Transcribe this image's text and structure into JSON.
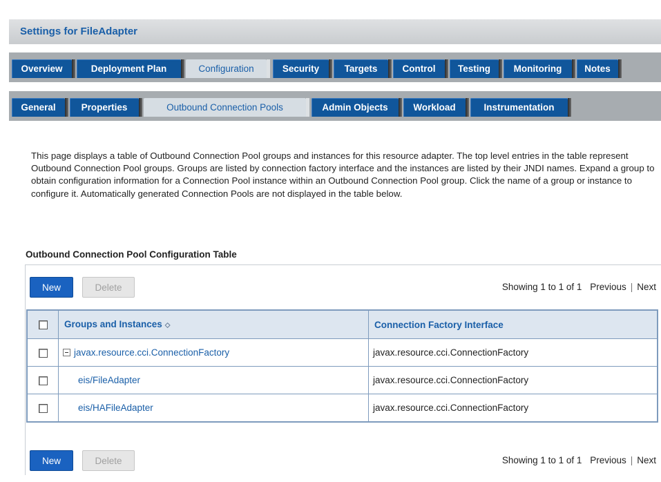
{
  "header": {
    "title": "Settings for FileAdapter"
  },
  "main_tabs": [
    {
      "label": "Overview",
      "active": false
    },
    {
      "label": "Deployment Plan",
      "active": false
    },
    {
      "label": "Configuration",
      "active": true
    },
    {
      "label": "Security",
      "active": false
    },
    {
      "label": "Targets",
      "active": false
    },
    {
      "label": "Control",
      "active": false
    },
    {
      "label": "Testing",
      "active": false
    },
    {
      "label": "Monitoring",
      "active": false
    },
    {
      "label": "Notes",
      "active": false
    }
  ],
  "sub_tabs": [
    {
      "label": "General",
      "active": false
    },
    {
      "label": "Properties",
      "active": false
    },
    {
      "label": "Outbound Connection Pools",
      "active": true
    },
    {
      "label": "Admin Objects",
      "active": false
    },
    {
      "label": "Workload",
      "active": false
    },
    {
      "label": "Instrumentation",
      "active": false
    }
  ],
  "description": "This page displays a table of Outbound Connection Pool groups and instances for this resource adapter. The top level entries in the table represent Outbound Connection Pool groups. Groups are listed by connection factory interface and the instances are listed by their JNDI names. Expand a group to obtain configuration information for a Connection Pool instance within an Outbound Connection Pool group. Click the name of a group or instance to configure it. Automatically generated Connection Pools are not displayed in the table below.",
  "table": {
    "title": "Outbound Connection Pool Configuration Table",
    "new_label": "New",
    "delete_label": "Delete",
    "showing": "Showing 1 to 1 of 1",
    "previous": "Previous",
    "next": "Next",
    "columns": [
      "Groups and Instances",
      "Connection Factory Interface"
    ],
    "rows": [
      {
        "name": "javax.resource.cci.ConnectionFactory",
        "interface": "javax.resource.cci.ConnectionFactory",
        "is_group": true
      },
      {
        "name": "eis/FileAdapter",
        "interface": "javax.resource.cci.ConnectionFactory",
        "is_group": false
      },
      {
        "name": "eis/HAFileAdapter",
        "interface": "javax.resource.cci.ConnectionFactory",
        "is_group": false
      }
    ]
  },
  "icons": {
    "sort": "sort-ascending-icon",
    "collapse": "collapse-minus-icon",
    "checkbox": "checkbox-icon"
  },
  "colors": {
    "tab_blue": "#10569b",
    "link_blue": "#1a5fa8",
    "tabstrip_gray": "#a7acb0",
    "header_fill": "#dde6f0",
    "grid_border": "#7e9bbd"
  }
}
